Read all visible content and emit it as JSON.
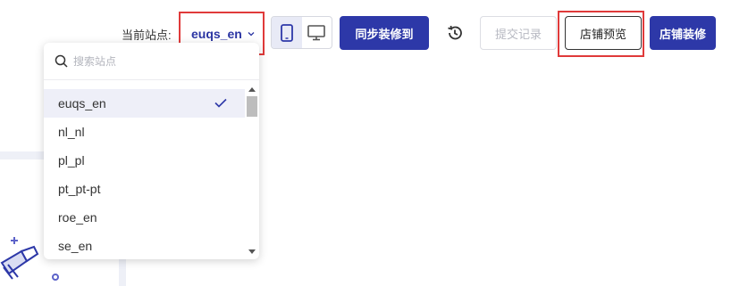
{
  "toolbar": {
    "site_label": "当前站点:",
    "current_site": "euqs_en",
    "sync_button": "同步装修到",
    "submit_button": "提交记录",
    "preview_button": "店铺预览",
    "decorate_button": "店铺装修"
  },
  "dropdown": {
    "search_placeholder": "搜索站点",
    "items": [
      {
        "label": "euqs_en",
        "selected": true
      },
      {
        "label": "nl_nl",
        "selected": false
      },
      {
        "label": "pl_pl",
        "selected": false
      },
      {
        "label": "pt_pt-pt",
        "selected": false
      },
      {
        "label": "roe_en",
        "selected": false
      },
      {
        "label": "se_en",
        "selected": false
      }
    ]
  },
  "colors": {
    "primary": "#2d38a8",
    "highlight": "#e03a3a",
    "selected_bg": "#eeeff8"
  },
  "icons": [
    "chevron-down-icon",
    "tablet-icon",
    "desktop-icon",
    "history-icon",
    "search-icon",
    "check-icon"
  ]
}
